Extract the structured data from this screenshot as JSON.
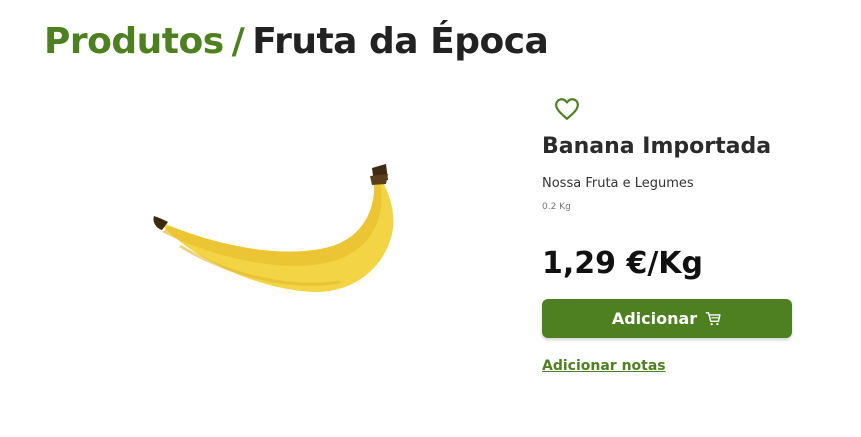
{
  "breadcrumb": {
    "parent": "Produtos",
    "separator": "/",
    "current": "Fruta da Época"
  },
  "product": {
    "image_alt": "Banana",
    "name": "Banana Importada",
    "brand": "Nossa Fruta e Legumes",
    "weight": "0.2 Kg",
    "price": "1,29 €/Kg"
  },
  "actions": {
    "add_label": "Adicionar",
    "notes_label": "Adicionar notas"
  },
  "icons": {
    "favorite": "heart-outline-icon",
    "cart": "cart-icon"
  },
  "colors": {
    "accent": "#4e8022",
    "text": "#222222"
  }
}
